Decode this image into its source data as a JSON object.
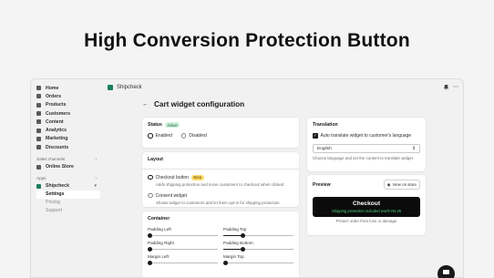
{
  "headline": "High Conversion Protection Button",
  "topbar": {
    "app_name": "Shipcheck",
    "icons": [
      "pin-icon",
      "more-icon"
    ]
  },
  "sidebar": {
    "items": [
      {
        "label": "Home",
        "icon": "home-icon"
      },
      {
        "label": "Orders",
        "icon": "orders-icon"
      },
      {
        "label": "Products",
        "icon": "products-icon"
      },
      {
        "label": "Customers",
        "icon": "customers-icon"
      },
      {
        "label": "Content",
        "icon": "content-icon"
      },
      {
        "label": "Analytics",
        "icon": "analytics-icon"
      },
      {
        "label": "Marketing",
        "icon": "marketing-icon"
      },
      {
        "label": "Discounts",
        "icon": "discounts-icon"
      }
    ],
    "sales_channels_label": "Sales channels",
    "online_store": "Online Store",
    "apps_label": "Apps",
    "app_entry": "Shipcheck",
    "sub_items": [
      "Settings",
      "Pricing",
      "Support"
    ]
  },
  "page": {
    "title": "Cart widget configuration"
  },
  "status_card": {
    "title": "Status",
    "badge": "Active",
    "options": [
      "Enabled",
      "Disabled"
    ],
    "selected": "Enabled"
  },
  "layout_card": {
    "title": "Layout",
    "option1_label": "Checkout button",
    "option1_badge": "Beta",
    "option1_desc": "Adds shipping protection and move customers to checkout when clicked",
    "option2_label": "Consent widget",
    "option2_desc": "Shows widget to customers and let them opt-in for shipping protection."
  },
  "container_card": {
    "title": "Container",
    "sliders": [
      {
        "label": "Padding Left",
        "value": 0.0
      },
      {
        "label": "Padding Top",
        "value": 0.25
      },
      {
        "label": "Padding Right",
        "value": 0.0
      },
      {
        "label": "Padding Bottom",
        "value": 0.25
      },
      {
        "label": "Margin Left",
        "value": 0.0
      },
      {
        "label": "Margin Top",
        "value": 0.0
      }
    ]
  },
  "translation_card": {
    "title": "Translation",
    "checkbox_label": "Auto translate widget to customer's language",
    "checked": true,
    "language": "English",
    "help": "Choose language and set the content to translate widget"
  },
  "preview_card": {
    "title": "Preview",
    "view_button": "View on store",
    "checkout_label": "Checkout",
    "checkout_sub": "Shipping protection included worth Rs.25",
    "protect_text": "Protect order from loss or damage"
  },
  "colors": {
    "accent": "#1a1a1a",
    "active_badge_bg": "#cdeed9",
    "beta_badge_bg": "#ffd96a",
    "protection_green": "#4cd37c"
  }
}
